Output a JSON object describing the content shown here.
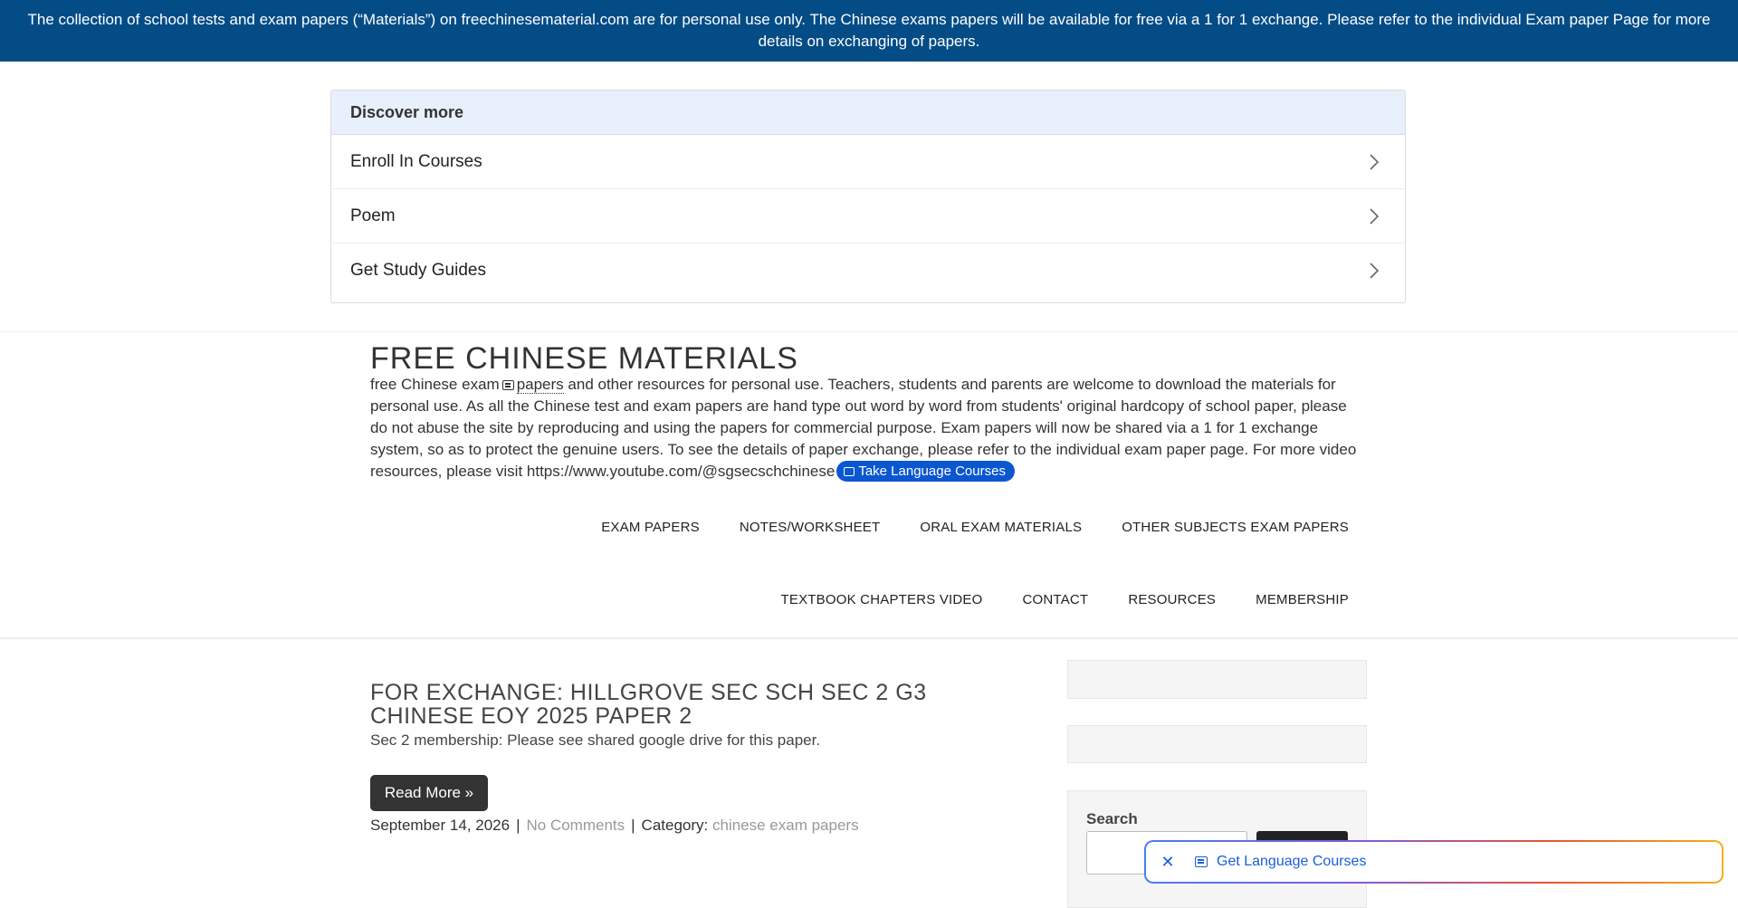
{
  "notice": {
    "text": "The collection of school tests and exam papers (“Materials”) on freechinesematerial.com are for personal use only. The Chinese exams papers will be available for free via a 1 for 1 exchange. Please refer to the individual Exam paper Page for more details on exchanging of papers.",
    "background_color": "#044c86"
  },
  "discover": {
    "header": "Discover more",
    "items": [
      {
        "label": "Enroll In Courses",
        "icon": "chevron-right-icon"
      },
      {
        "label": "Poem",
        "icon": "chevron-right-icon"
      },
      {
        "label": "Get Study Guides",
        "icon": "chevron-right-icon"
      }
    ]
  },
  "site": {
    "title": "FREE CHINESE MATERIALS",
    "desc_part1": "free Chinese exam",
    "desc_link": "papers",
    "desc_part2": "and other resources for personal use. Teachers, students and parents are welcome to download the materials for personal use. As all the Chinese test and exam papers are hand type out word by word from students' original hardcopy of school paper, please do not abuse the site by reproducing and using the papers for commercial purpose. Exam papers will now be shared via a 1 for 1 exchange system, so as to protect the genuine users. To see the details of paper exchange, please refer to the individual exam paper page. For more video resources, please visit https://www.youtube.com/@sgsecschchinese",
    "pill_label": "Take Language Courses",
    "pill_color": "#0a57d0"
  },
  "nav": {
    "row1": [
      "EXAM PAPERS",
      "NOTES/WORKSHEET",
      "ORAL EXAM MATERIALS",
      "OTHER SUBJECTS EXAM PAPERS"
    ],
    "row2": [
      "TEXTBOOK CHAPTERS VIDEO",
      "CONTACT",
      "RESOURCES",
      "MEMBERSHIP"
    ]
  },
  "post": {
    "title": "FOR EXCHANGE: HILLGROVE SEC SCH SEC 2 G3 CHINESE EOY 2025 PAPER 2",
    "excerpt": "Sec 2 membership: Please see shared google drive for this paper.",
    "read_more": "Read More »",
    "date": "September 14, 2026",
    "separator": "|",
    "comments": "No Comments",
    "category_label": "Category:",
    "category": "chinese exam papers"
  },
  "sidebar": {
    "search_label": "Search"
  },
  "floating_bar": {
    "close_icon": "close-icon",
    "label": "Get Language Courses",
    "accent_color": "#1a5fd6"
  }
}
